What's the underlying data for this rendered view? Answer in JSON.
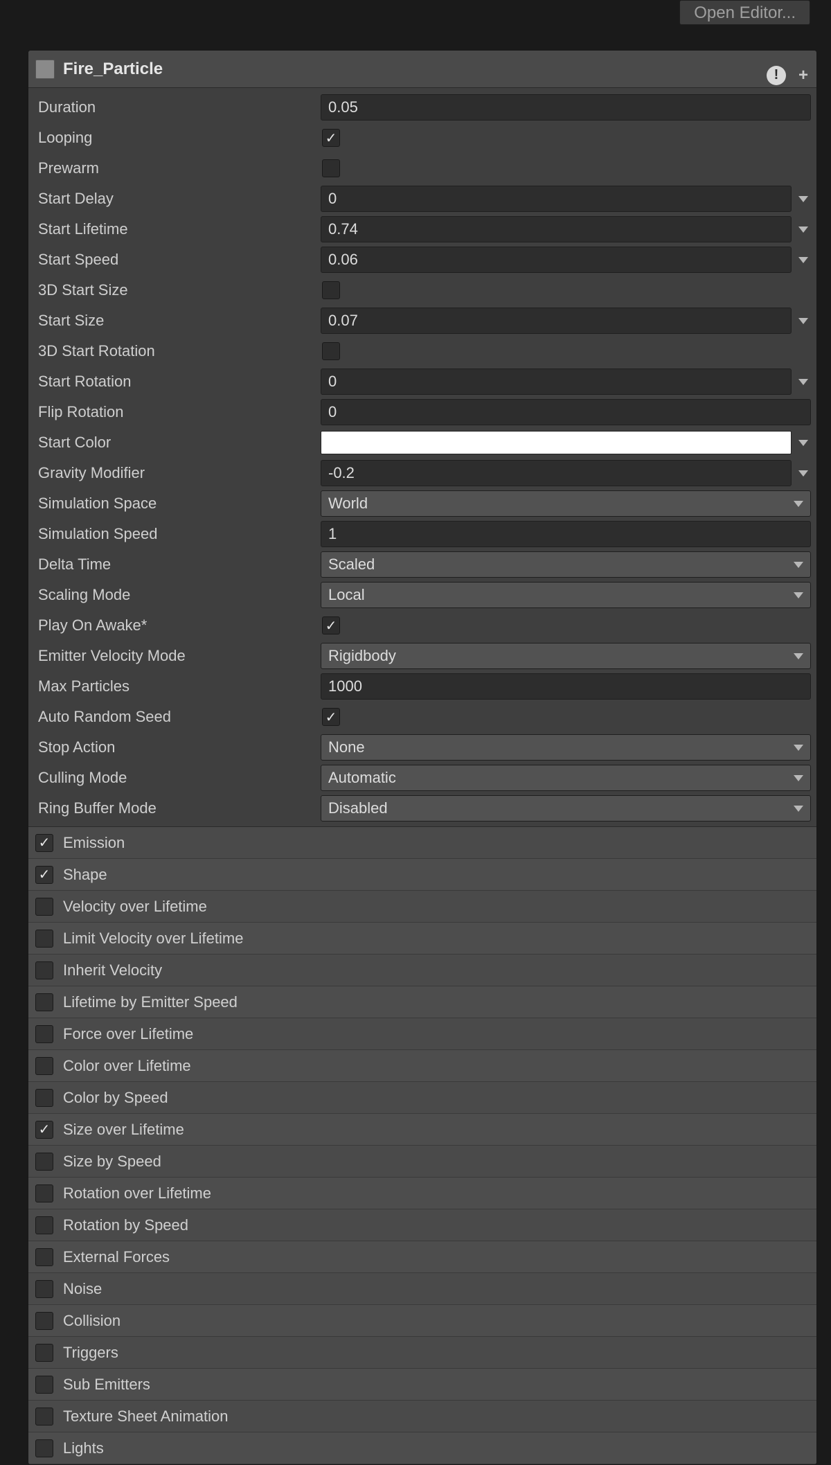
{
  "topbar": {
    "open_editor": "Open Editor..."
  },
  "header": {
    "title": "Fire_Particle"
  },
  "props": {
    "duration": {
      "label": "Duration",
      "value": "0.05"
    },
    "looping": {
      "label": "Looping",
      "checked": true
    },
    "prewarm": {
      "label": "Prewarm",
      "checked": false
    },
    "start_delay": {
      "label": "Start Delay",
      "value": "0"
    },
    "start_lifetime": {
      "label": "Start Lifetime",
      "value": "0.74"
    },
    "start_speed": {
      "label": "Start Speed",
      "value": "0.06"
    },
    "size3d": {
      "label": "3D Start Size",
      "checked": false
    },
    "start_size": {
      "label": "Start Size",
      "value": "0.07"
    },
    "rot3d": {
      "label": "3D Start Rotation",
      "checked": false
    },
    "start_rotation": {
      "label": "Start Rotation",
      "value": "0"
    },
    "flip_rotation": {
      "label": "Flip Rotation",
      "value": "0"
    },
    "start_color": {
      "label": "Start Color",
      "value": "#ffffff"
    },
    "gravity": {
      "label": "Gravity Modifier",
      "value": "-0.2"
    },
    "sim_space": {
      "label": "Simulation Space",
      "value": "World"
    },
    "sim_speed": {
      "label": "Simulation Speed",
      "value": "1"
    },
    "delta_time": {
      "label": "Delta Time",
      "value": "Scaled"
    },
    "scaling_mode": {
      "label": "Scaling Mode",
      "value": "Local"
    },
    "play_awake": {
      "label": "Play On Awake*",
      "checked": true
    },
    "emitter_vel": {
      "label": "Emitter Velocity Mode",
      "value": "Rigidbody"
    },
    "max_particles": {
      "label": "Max Particles",
      "value": "1000"
    },
    "auto_seed": {
      "label": "Auto Random Seed",
      "checked": true
    },
    "stop_action": {
      "label": "Stop Action",
      "value": "None"
    },
    "culling_mode": {
      "label": "Culling Mode",
      "value": "Automatic"
    },
    "ring_buffer": {
      "label": "Ring Buffer Mode",
      "value": "Disabled"
    }
  },
  "modules": [
    {
      "label": "Emission",
      "checked": true
    },
    {
      "label": "Shape",
      "checked": true
    },
    {
      "label": "Velocity over Lifetime",
      "checked": false
    },
    {
      "label": "Limit Velocity over Lifetime",
      "checked": false
    },
    {
      "label": "Inherit Velocity",
      "checked": false
    },
    {
      "label": "Lifetime by Emitter Speed",
      "checked": false
    },
    {
      "label": "Force over Lifetime",
      "checked": false
    },
    {
      "label": "Color over Lifetime",
      "checked": false
    },
    {
      "label": "Color by Speed",
      "checked": false
    },
    {
      "label": "Size over Lifetime",
      "checked": true
    },
    {
      "label": "Size by Speed",
      "checked": false
    },
    {
      "label": "Rotation over Lifetime",
      "checked": false
    },
    {
      "label": "Rotation by Speed",
      "checked": false
    },
    {
      "label": "External Forces",
      "checked": false
    },
    {
      "label": "Noise",
      "checked": false
    },
    {
      "label": "Collision",
      "checked": false
    },
    {
      "label": "Triggers",
      "checked": false
    },
    {
      "label": "Sub Emitters",
      "checked": false
    },
    {
      "label": "Texture Sheet Animation",
      "checked": false
    },
    {
      "label": "Lights",
      "checked": false
    }
  ]
}
